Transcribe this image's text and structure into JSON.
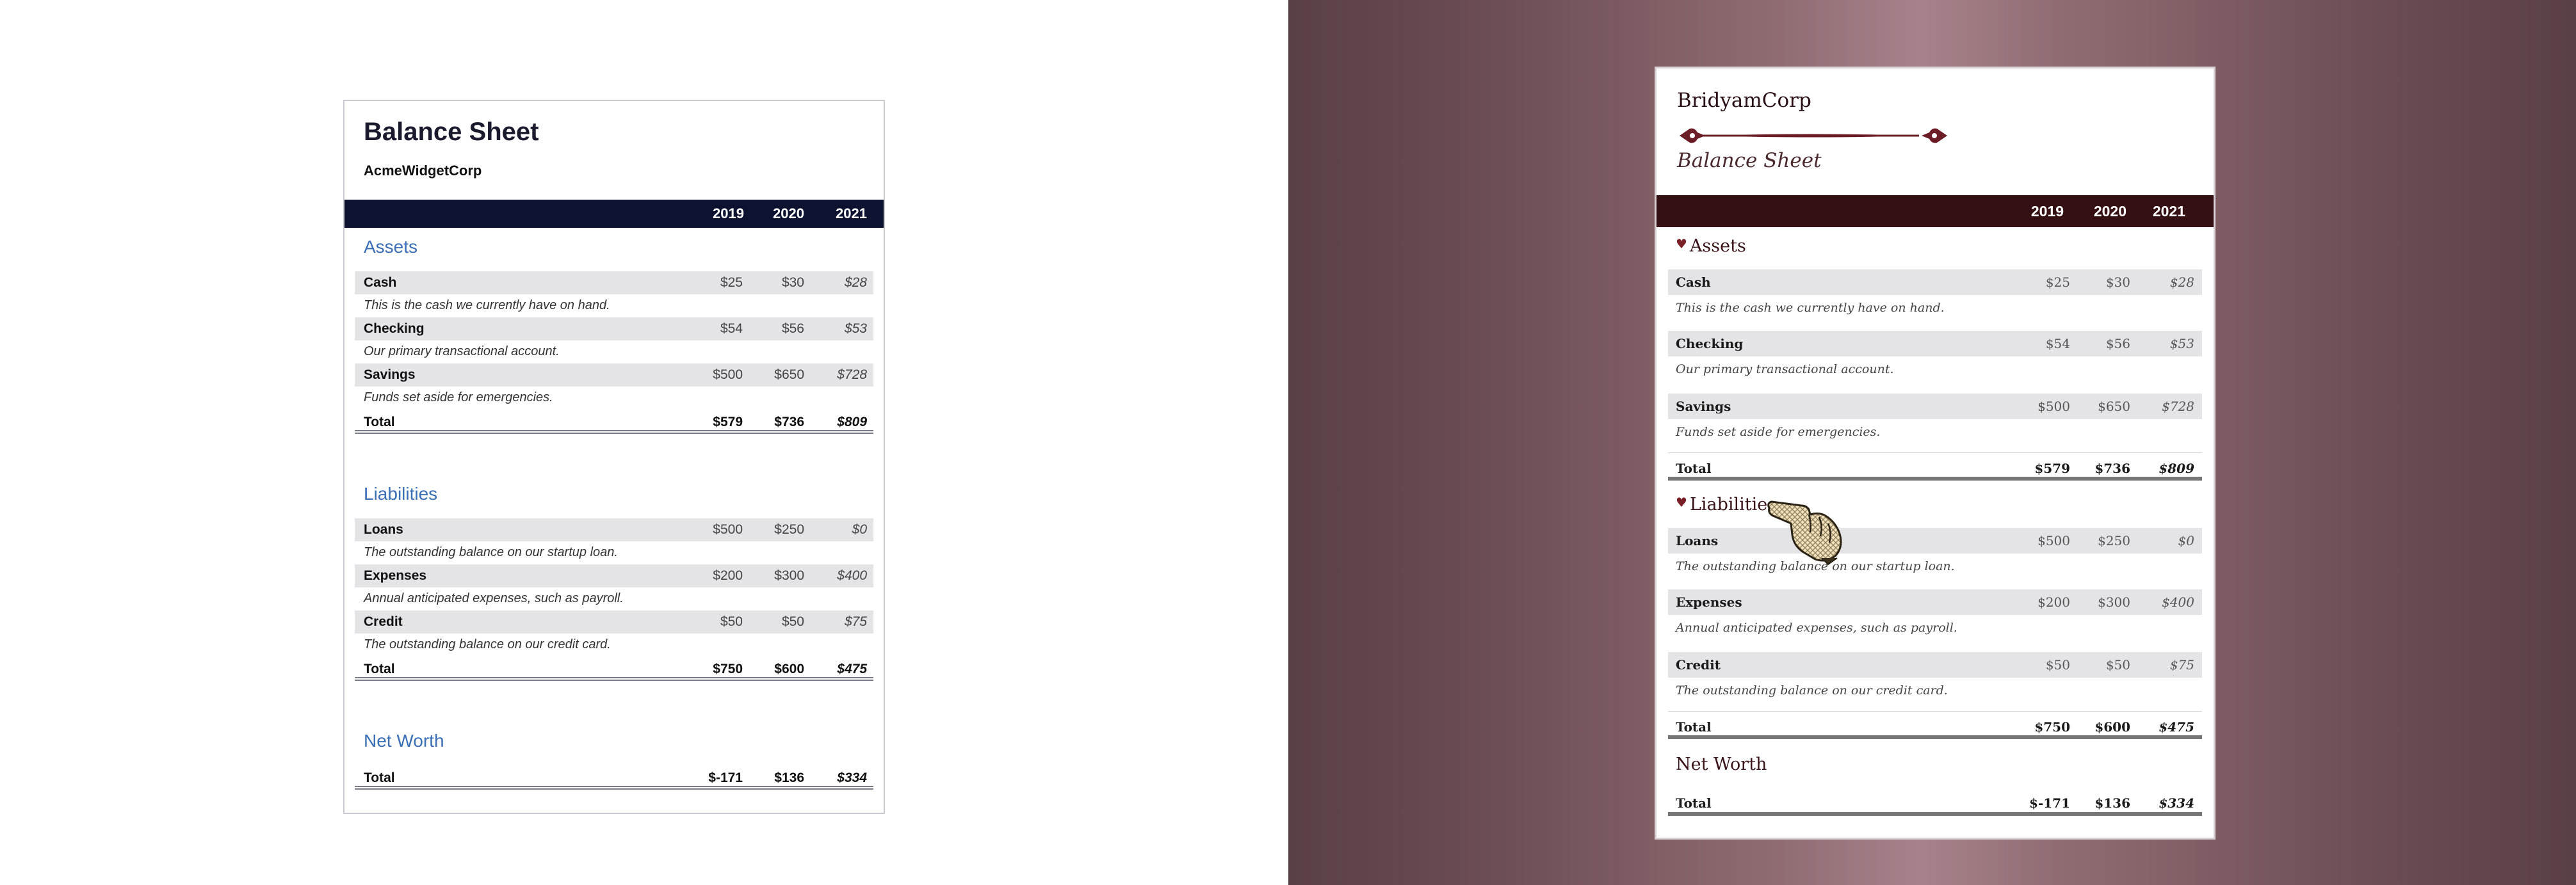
{
  "years": [
    "2019",
    "2020",
    "2021"
  ],
  "plain": {
    "title": "Balance Sheet",
    "company": "AcmeWidgetCorp",
    "assets": {
      "heading": "Assets",
      "items": [
        {
          "label": "Cash",
          "v": [
            "$25",
            "$30",
            "$28"
          ],
          "desc": "This is the cash we currently have on hand."
        },
        {
          "label": "Checking",
          "v": [
            "$54",
            "$56",
            "$53"
          ],
          "desc": "Our primary transactional account."
        },
        {
          "label": "Savings",
          "v": [
            "$500",
            "$650",
            "$728"
          ],
          "desc": "Funds set aside for emergencies."
        }
      ],
      "total_label": "Total",
      "total": [
        "$579",
        "$736",
        "$809"
      ]
    },
    "liabilities": {
      "heading": "Liabilities",
      "items": [
        {
          "label": "Loans",
          "v": [
            "$500",
            "$250",
            "$0"
          ],
          "desc": "The outstanding balance on our startup loan."
        },
        {
          "label": "Expenses",
          "v": [
            "$200",
            "$300",
            "$400"
          ],
          "desc": "Annual anticipated expenses, such as payroll."
        },
        {
          "label": "Credit",
          "v": [
            "$50",
            "$50",
            "$75"
          ],
          "desc": "The outstanding balance on our credit card."
        }
      ],
      "total_label": "Total",
      "total": [
        "$750",
        "$600",
        "$475"
      ]
    },
    "networth": {
      "heading": "Net Worth",
      "total_label": "Total",
      "total": [
        "$-171",
        "$136",
        "$334"
      ]
    }
  },
  "ornate": {
    "company": "BridyamCorp",
    "subtitle": "Balance Sheet",
    "accent": "#340f13",
    "assets": {
      "heading": "Assets",
      "items": [
        {
          "label": "Cash",
          "v": [
            "$25",
            "$30",
            "$28"
          ],
          "desc": "This is the cash we currently have on hand."
        },
        {
          "label": "Checking",
          "v": [
            "$54",
            "$56",
            "$53"
          ],
          "desc": "Our primary transactional account."
        },
        {
          "label": "Savings",
          "v": [
            "$500",
            "$650",
            "$728"
          ],
          "desc": "Funds set aside for emergencies."
        }
      ],
      "total_label": "Total",
      "total": [
        "$579",
        "$736",
        "$809"
      ]
    },
    "liabilities": {
      "heading": "Liabilities",
      "items": [
        {
          "label": "Loans",
          "v": [
            "$500",
            "$250",
            "$0"
          ],
          "desc": "The outstanding balance on our startup loan."
        },
        {
          "label": "Expenses",
          "v": [
            "$200",
            "$300",
            "$400"
          ],
          "desc": "Annual anticipated expenses, such as payroll."
        },
        {
          "label": "Credit",
          "v": [
            "$50",
            "$50",
            "$75"
          ],
          "desc": "The outstanding balance on our credit card."
        }
      ],
      "total_label": "Total",
      "total": [
        "$750",
        "$600",
        "$475"
      ]
    },
    "networth": {
      "heading": "Net Worth",
      "total_label": "Total",
      "total": [
        "$-171",
        "$136",
        "$334"
      ]
    }
  },
  "icons": {
    "heart": "heart-icon",
    "flourish": "flourish-divider-icon",
    "cursor": "pointing-hand-cursor-icon"
  }
}
